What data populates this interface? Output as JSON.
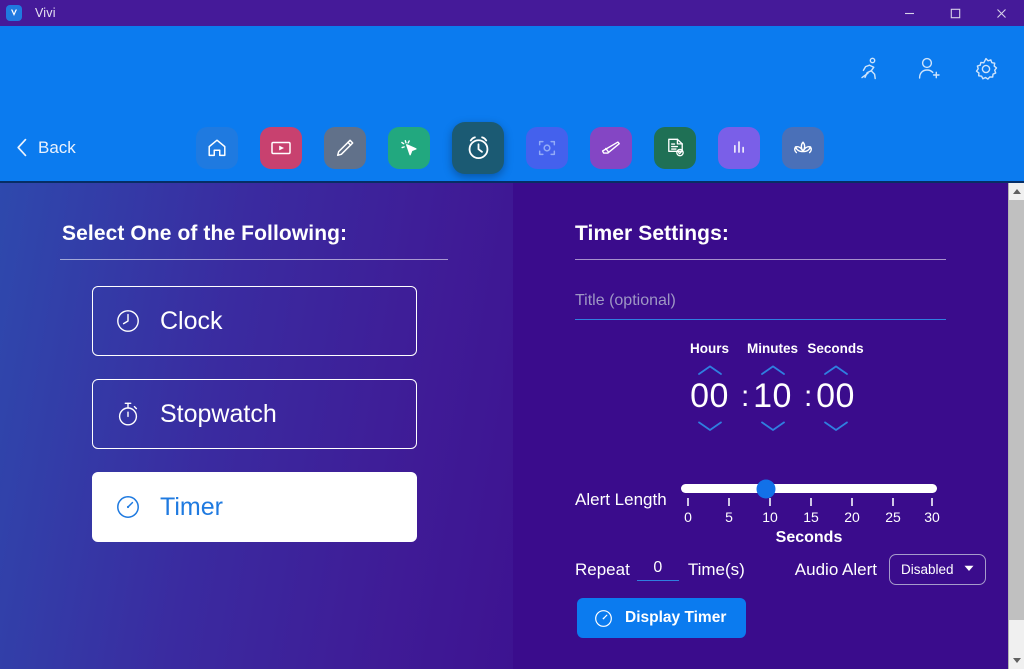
{
  "window": {
    "title": "Vivi",
    "logo_icon": "vivi-logo-icon",
    "minimize_label": "minimize-icon",
    "maximize_label": "maximize-icon",
    "close_label": "close-icon"
  },
  "header": {
    "icons": [
      {
        "name": "running-person-icon",
        "label": "Activity"
      },
      {
        "name": "add-user-icon",
        "label": "Add User"
      },
      {
        "name": "gear-icon",
        "label": "Settings"
      }
    ]
  },
  "toolbar": {
    "back_label": "Back",
    "back_icon": "chevron-left-icon",
    "tools": [
      {
        "name": "home-icon",
        "label": "Home",
        "color": "#1f7ae0",
        "active": false
      },
      {
        "name": "video-icon",
        "label": "Video",
        "color": "#c8416f",
        "active": false
      },
      {
        "name": "pencil-icon",
        "label": "Annotate",
        "color": "#61718a",
        "active": false
      },
      {
        "name": "cursor-click-icon",
        "label": "Pointer",
        "color": "#22a87f",
        "active": false
      },
      {
        "name": "alarm-clock-icon",
        "label": "Clock Tools",
        "color": "#1b5a73",
        "active": true
      },
      {
        "name": "focus-capture-icon",
        "label": "Snapshot",
        "color": "#4461ed",
        "active": false
      },
      {
        "name": "eraser-icon",
        "label": "Eraser",
        "color": "#8446c4",
        "active": false
      },
      {
        "name": "quiz-doc-icon",
        "label": "Quiz",
        "color": "#1f7055",
        "active": false
      },
      {
        "name": "bar-chart-icon",
        "label": "Poll",
        "color": "#7a5fe8",
        "active": false
      },
      {
        "name": "lotus-icon",
        "label": "Mindfulness",
        "color": "#4a70b8",
        "active": false
      }
    ]
  },
  "left_panel": {
    "heading": "Select One of the Following:",
    "options": [
      {
        "label": "Clock",
        "icon": "clock-icon",
        "selected": false
      },
      {
        "label": "Stopwatch",
        "icon": "stopwatch-icon",
        "selected": false
      },
      {
        "label": "Timer",
        "icon": "timer-icon",
        "selected": true
      }
    ]
  },
  "right_panel": {
    "heading": "Timer Settings:",
    "title_input": {
      "value": "",
      "placeholder": "Title (optional)"
    },
    "time": {
      "labels": {
        "hours": "Hours",
        "minutes": "Minutes",
        "seconds": "Seconds"
      },
      "hours": "00",
      "minutes": "10",
      "seconds": "00",
      "separator": ":",
      "up_icon": "chevron-up-icon",
      "down_icon": "chevron-down-icon"
    },
    "alert_length": {
      "label": "Alert Length",
      "unit_label": "Seconds",
      "value": 10,
      "min": 0,
      "max": 30,
      "ticks": [
        0,
        5,
        10,
        15,
        20,
        25,
        30
      ],
      "tick_labels": [
        "0",
        "5",
        "10",
        "15",
        "20",
        "25",
        "30"
      ],
      "thumb_color": "#1271e8",
      "track_color": "#ffffff"
    },
    "repeat": {
      "prefix_label": "Repeat",
      "value": "0",
      "suffix_label": "Time(s)"
    },
    "audio_alert": {
      "label": "Audio Alert",
      "value": "Disabled",
      "caret_icon": "caret-down-icon",
      "options": [
        "Disabled"
      ]
    },
    "display_button": {
      "label": "Display Timer",
      "icon": "timer-icon",
      "color": "#0b7bef"
    }
  },
  "scrollbar": {
    "up_icon": "scroll-up-arrow-icon",
    "down_icon": "scroll-down-arrow-icon"
  }
}
